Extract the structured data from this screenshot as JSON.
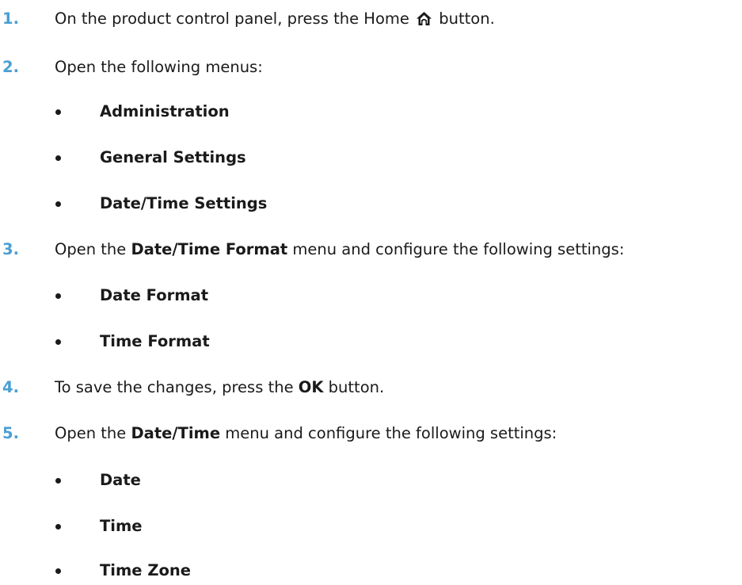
{
  "steps": [
    {
      "number": "1.",
      "pre": "On the product control panel, press the Home",
      "icon": "home-icon",
      "post": "button."
    },
    {
      "number": "2.",
      "text": "Open the following menus:"
    },
    {
      "number": "3.",
      "pre": "Open the",
      "bold": "Date/Time Format",
      "post": "menu and configure the following settings:"
    },
    {
      "number": "4.",
      "pre": "To save the changes, press the",
      "bold": "OK",
      "post": "button."
    },
    {
      "number": "5.",
      "pre": "Open the",
      "bold": "Date/Time",
      "post": "menu and configure the following settings:"
    }
  ],
  "menus_step2": [
    "Administration",
    "General Settings",
    "Date/Time Settings"
  ],
  "settings_step3": [
    "Date Format",
    "Time Format"
  ],
  "settings_step5": [
    "Date",
    "Time",
    "Time Zone"
  ]
}
